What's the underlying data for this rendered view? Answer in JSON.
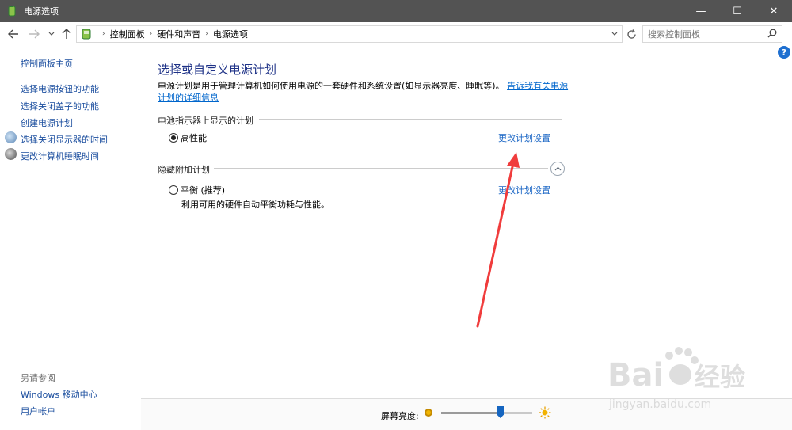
{
  "window": {
    "title": "电源选项",
    "minimize_glyph": "—",
    "maximize_glyph": "☐",
    "close_glyph": "✕"
  },
  "address": {
    "crumbs": [
      "控制面板",
      "硬件和声音",
      "电源选项"
    ],
    "search_placeholder": "搜索控制面板"
  },
  "help_glyph": "?",
  "sidebar": {
    "home": "控制面板主页",
    "items": [
      {
        "label": "选择电源按钮的功能"
      },
      {
        "label": "选择关闭盖子的功能"
      },
      {
        "label": "创建电源计划"
      },
      {
        "label": "选择关闭显示器的时间",
        "icon": "monitor-icon"
      },
      {
        "label": "更改计算机睡眠时间",
        "icon": "moon-icon"
      }
    ],
    "see_also": "另请参阅",
    "see_also_items": [
      "Windows 移动中心",
      "用户帐户"
    ]
  },
  "main": {
    "title": "选择或自定义电源计划",
    "description": "电源计划是用于管理计算机如何使用电源的一套硬件和系统设置(如显示器亮度、睡眠等)。",
    "description_link": "告诉我有关电源计划的详细信息",
    "section_shown": "电池指示器上显示的计划",
    "section_hidden": "隐藏附加计划",
    "plans": [
      {
        "name": "高性能",
        "selected": true,
        "change_link": "更改计划设置"
      },
      {
        "name": "平衡 (推荐)",
        "selected": false,
        "description": "利用可用的硬件自动平衡功耗与性能。",
        "change_link": "更改计划设置"
      }
    ]
  },
  "brightness": {
    "label": "屏幕亮度:",
    "level_percent": 65
  },
  "colors": {
    "accent": "#1e6fd0",
    "link": "#1a4d9e",
    "annotation_arrow": "#f03c3c",
    "titlebar": "#535353"
  },
  "watermark": {
    "brand": "Baidu",
    "brand_cn": "经验",
    "url": "jingyan.baidu.com"
  }
}
